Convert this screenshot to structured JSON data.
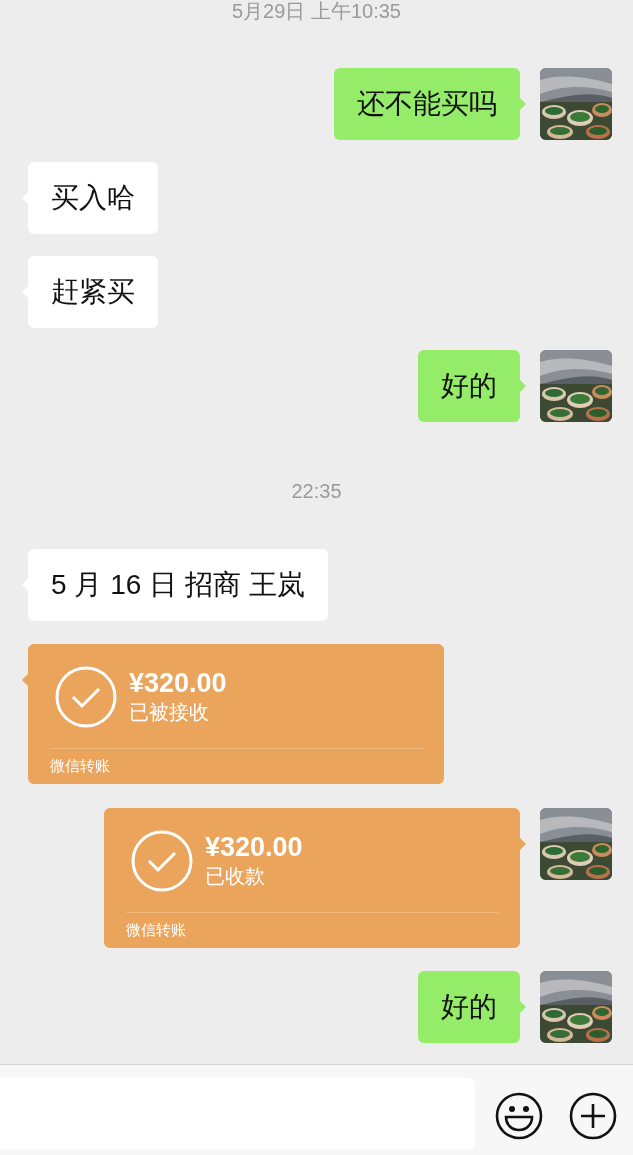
{
  "messages": [
    {
      "kind": "time",
      "text": "5月29日 上午10:35"
    },
    {
      "kind": "text",
      "outgoing": true,
      "text": "还不能买吗"
    },
    {
      "kind": "text",
      "outgoing": false,
      "text": "买入哈"
    },
    {
      "kind": "text",
      "outgoing": false,
      "text": "赶紧买"
    },
    {
      "kind": "text",
      "outgoing": true,
      "text": "好的"
    },
    {
      "kind": "time",
      "text": "22:35"
    },
    {
      "kind": "text",
      "outgoing": false,
      "text": "5 月 16 日 招商 王岚"
    },
    {
      "kind": "transfer",
      "outgoing": false,
      "amount": "¥320.00",
      "status": "已被接收",
      "footer": "微信转账"
    },
    {
      "kind": "transfer",
      "outgoing": true,
      "amount": "¥320.00",
      "status": "已收款",
      "footer": "微信转账"
    },
    {
      "kind": "text",
      "outgoing": true,
      "text": "好的"
    }
  ]
}
